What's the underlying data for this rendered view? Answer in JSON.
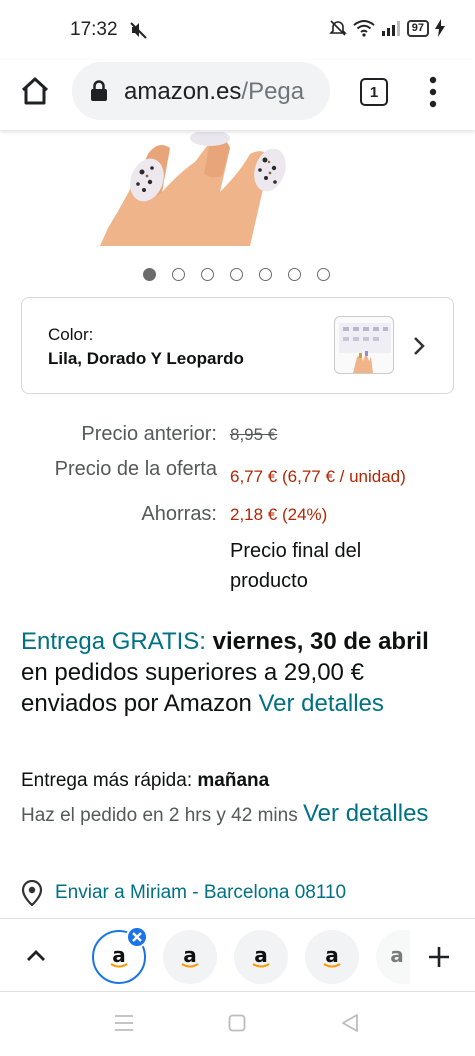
{
  "status_bar": {
    "time": "17:32",
    "battery": "97",
    "icons": [
      "mute-icon",
      "alarm-off-icon",
      "wifi-icon",
      "signal-icon",
      "battery-icon",
      "charging-icon"
    ]
  },
  "browser": {
    "url_main": "amazon.es",
    "url_rest": "/Pega",
    "tab_count": "1",
    "icons": [
      "home-icon",
      "lock-icon",
      "menu-dots-icon"
    ]
  },
  "gallery": {
    "dot_count": 7,
    "active_index": 0
  },
  "color_selector": {
    "label": "Color:",
    "value": "Lila, Dorado Y Leopardo"
  },
  "pricing": {
    "previous_label": "Precio anterior:",
    "previous_value": "8,95 €",
    "offer_label": "Precio de la oferta",
    "offer_value": "6,77 € (6,77 € / unidad)",
    "savings_label": "Ahorras:",
    "savings_value": "2,18 € (24%)",
    "final_note": "Precio final del producto"
  },
  "delivery": {
    "free_label": "Entrega GRATIS:",
    "date": "viernes, 30 de abril",
    "condition": "en pedidos superiores a 29,00 € enviados por Amazon",
    "details_link": "Ver detalles",
    "fast_label": "Entrega más rápida:",
    "fast_value": "mañana",
    "order_by": "Haz el pedido en 2 hrs y 42 mins",
    "order_details_link": "Ver detalles",
    "ship_to": "Enviar a Miriam - Barcelona 08110"
  },
  "tab_strip": {
    "tab_letter": "a"
  },
  "colors": {
    "teal_link": "#007185",
    "price_red": "#b12704",
    "active_tab_blue": "#1a73e8"
  }
}
